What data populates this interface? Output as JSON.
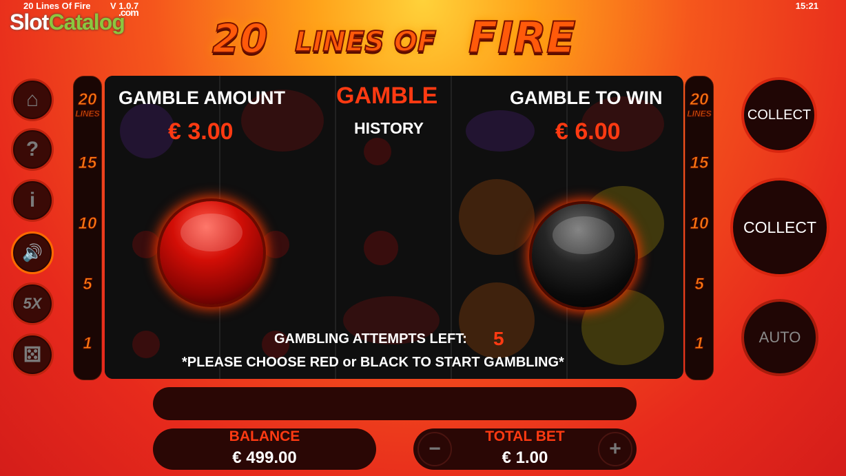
{
  "topbar": {
    "game_title": "20 Lines Of Fire",
    "version": "V 1.0.7",
    "clock": "15:21"
  },
  "watermark": {
    "slot": "Slot",
    "catalog": "Catalog",
    "com": ".com"
  },
  "logo": {
    "number": "20",
    "middle": "LINES OF",
    "fire": "FIRE"
  },
  "side_buttons": [
    {
      "name": "home",
      "icon": "home-icon",
      "glyph": "⌂"
    },
    {
      "name": "help",
      "icon": "question-icon",
      "glyph": "?"
    },
    {
      "name": "info",
      "icon": "info-icon",
      "glyph": "i"
    },
    {
      "name": "sound",
      "icon": "speaker-icon",
      "glyph": "🔊"
    },
    {
      "name": "turbo",
      "icon": "5x-icon",
      "glyph": "5X"
    },
    {
      "name": "gamble",
      "icon": "dice-icon",
      "glyph": "⚄"
    }
  ],
  "lines": {
    "top": "20",
    "top_sub": "LINES",
    "marks": [
      "15",
      "10",
      "5",
      "1"
    ]
  },
  "gamble": {
    "amount_label": "GAMBLE AMOUNT",
    "amount_value": "€ 3.00",
    "title": "GAMBLE",
    "history_label": "HISTORY",
    "win_label": "GAMBLE TO WIN",
    "win_value": "€ 6.00",
    "attempts_label": "GAMBLING ATTEMPTS LEFT:",
    "attempts_value": "5",
    "instruction": "*PLEASE CHOOSE RED or BLACK TO START GAMBLING*",
    "choices": [
      "red",
      "black"
    ]
  },
  "right_buttons": {
    "collect_small": "COLLECT",
    "collect_big": "COLLECT",
    "auto": "AUTO"
  },
  "bottom": {
    "balance_label": "BALANCE",
    "balance_value": "€ 499.00",
    "bet_label": "TOTAL BET",
    "bet_value": "€ 1.00",
    "minus": "−",
    "plus": "+"
  },
  "colors": {
    "accent": "#ff3a12",
    "frame": "#d8260f",
    "background": "#e72a1c"
  }
}
